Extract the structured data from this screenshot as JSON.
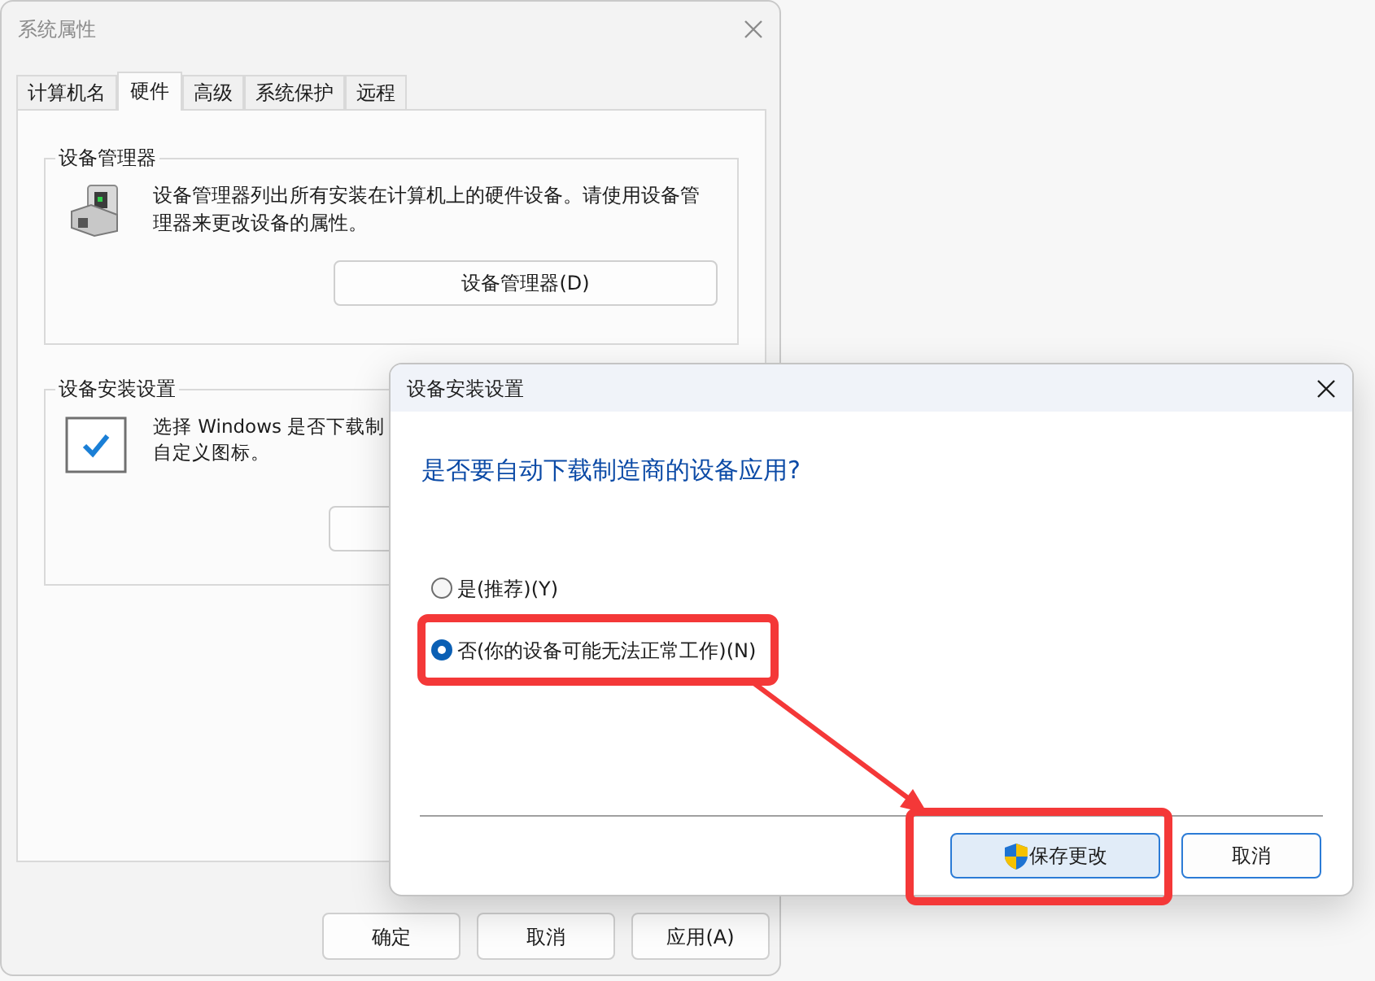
{
  "system_window": {
    "title": "系统属性",
    "tabs": [
      {
        "label": "计算机名",
        "selected": false
      },
      {
        "label": "硬件",
        "selected": true
      },
      {
        "label": "高级",
        "selected": false
      },
      {
        "label": "系统保护",
        "selected": false
      },
      {
        "label": "远程",
        "selected": false
      }
    ],
    "device_manager_group": {
      "title": "设备管理器",
      "description": "设备管理器列出所有安装在计算机上的硬件设备。请使用设备管理器来更改设备的属性。",
      "button": "设备管理器(D)"
    },
    "device_install_group": {
      "title": "设备安装设置",
      "description_lines": [
        "选择 Windows 是否下载制",
        "自定义图标。"
      ]
    },
    "buttons": [
      "确定",
      "取消",
      "应用(A)"
    ]
  },
  "dialog": {
    "title": "设备安装设置",
    "question": "是否要自动下载制造商的设备应用?",
    "options": [
      {
        "label": "是(推荐)(Y)",
        "selected": false
      },
      {
        "label": "否(你的设备可能无法正常工作)(N)",
        "selected": true
      }
    ],
    "buttons": [
      {
        "label": "保存更改",
        "kind": "primary"
      },
      {
        "label": "取消",
        "kind": "normal"
      }
    ]
  }
}
